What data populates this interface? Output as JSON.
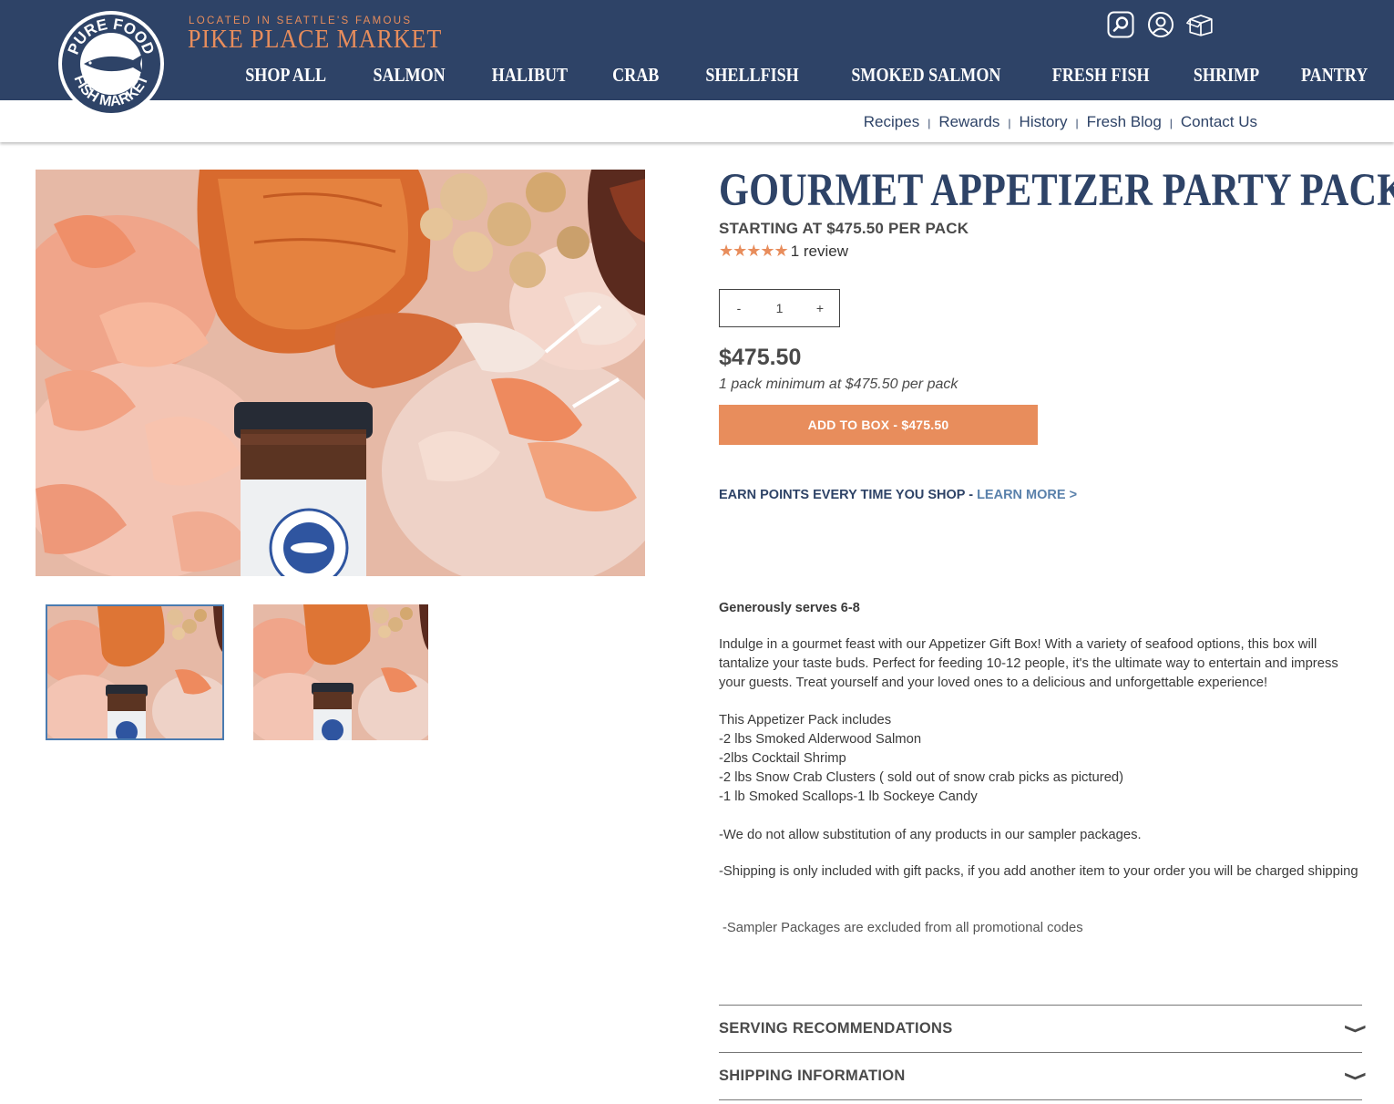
{
  "header": {
    "logo_text_top": "PURE FOOD",
    "logo_text_bottom": "FISH MARKET",
    "tagline": "LOCATED IN SEATTLE'S FAMOUS",
    "brand": "PIKE PLACE MARKET",
    "icons": [
      "search-icon",
      "account-icon",
      "box-icon"
    ]
  },
  "nav": {
    "items": [
      "SHOP ALL",
      "SALMON",
      "HALIBUT",
      "CRAB",
      "SHELLFISH",
      "SMOKED SALMON",
      "FRESH FISH",
      "SHRIMP",
      "PANTRY"
    ]
  },
  "subnav": {
    "links": [
      "Recipes",
      "Rewards",
      "History",
      "Fresh Blog",
      "Contact Us"
    ],
    "separator": "|"
  },
  "product": {
    "title": "GOURMET APPETIZER PARTY PACK",
    "starting_at": "STARTING AT $475.50 PER PACK",
    "rating_stars": 5,
    "stars_text": "★★★★★",
    "review_count": "1 review",
    "qty_minus": "-",
    "qty_value": "1",
    "qty_plus": "+",
    "price": "$475.50",
    "minimum": "1 pack minimum at $475.50 per pack",
    "add_button": "ADD TO BOX - $475.50",
    "earn_text": "EARN POINTS EVERY TIME YOU SHOP - ",
    "learn_more": "LEARN MORE >"
  },
  "description": {
    "serves": "Generously serves 6-8",
    "para1": "Indulge in a gourmet feast with our Appetizer Gift Box! With a variety of seafood options, this box will tantalize your taste buds. Perfect for feeding 10-12 people, it's the ultimate way to entertain and impress your guests. Treat yourself and your loved ones to a delicious and unforgettable experience!",
    "includes_heading": "This Appetizer Pack includes",
    "includes": [
      "-2 lbs Smoked Alderwood Salmon",
      "-2lbs Cocktail Shrimp",
      "-2 lbs Snow Crab Clusters ( sold out of snow crab picks as pictured)",
      "-1 lb Smoked Scallops-1 lb Sockeye Candy"
    ],
    "note1": "-We do not allow substitution of any products in our sampler packages.",
    "note2": "-Shipping is only included with gift packs, if you add another item to your order you will be charged shipping",
    "note3": "-Sampler Packages are excluded from all promotional codes"
  },
  "accordions": [
    {
      "label": "SERVING RECOMMENDATIONS",
      "chevron": "❯"
    },
    {
      "label": "SHIPPING INFORMATION",
      "chevron": "❯"
    }
  ],
  "colors": {
    "navy": "#2e4367",
    "accent": "#e88d5c",
    "link": "#5a81ab"
  }
}
